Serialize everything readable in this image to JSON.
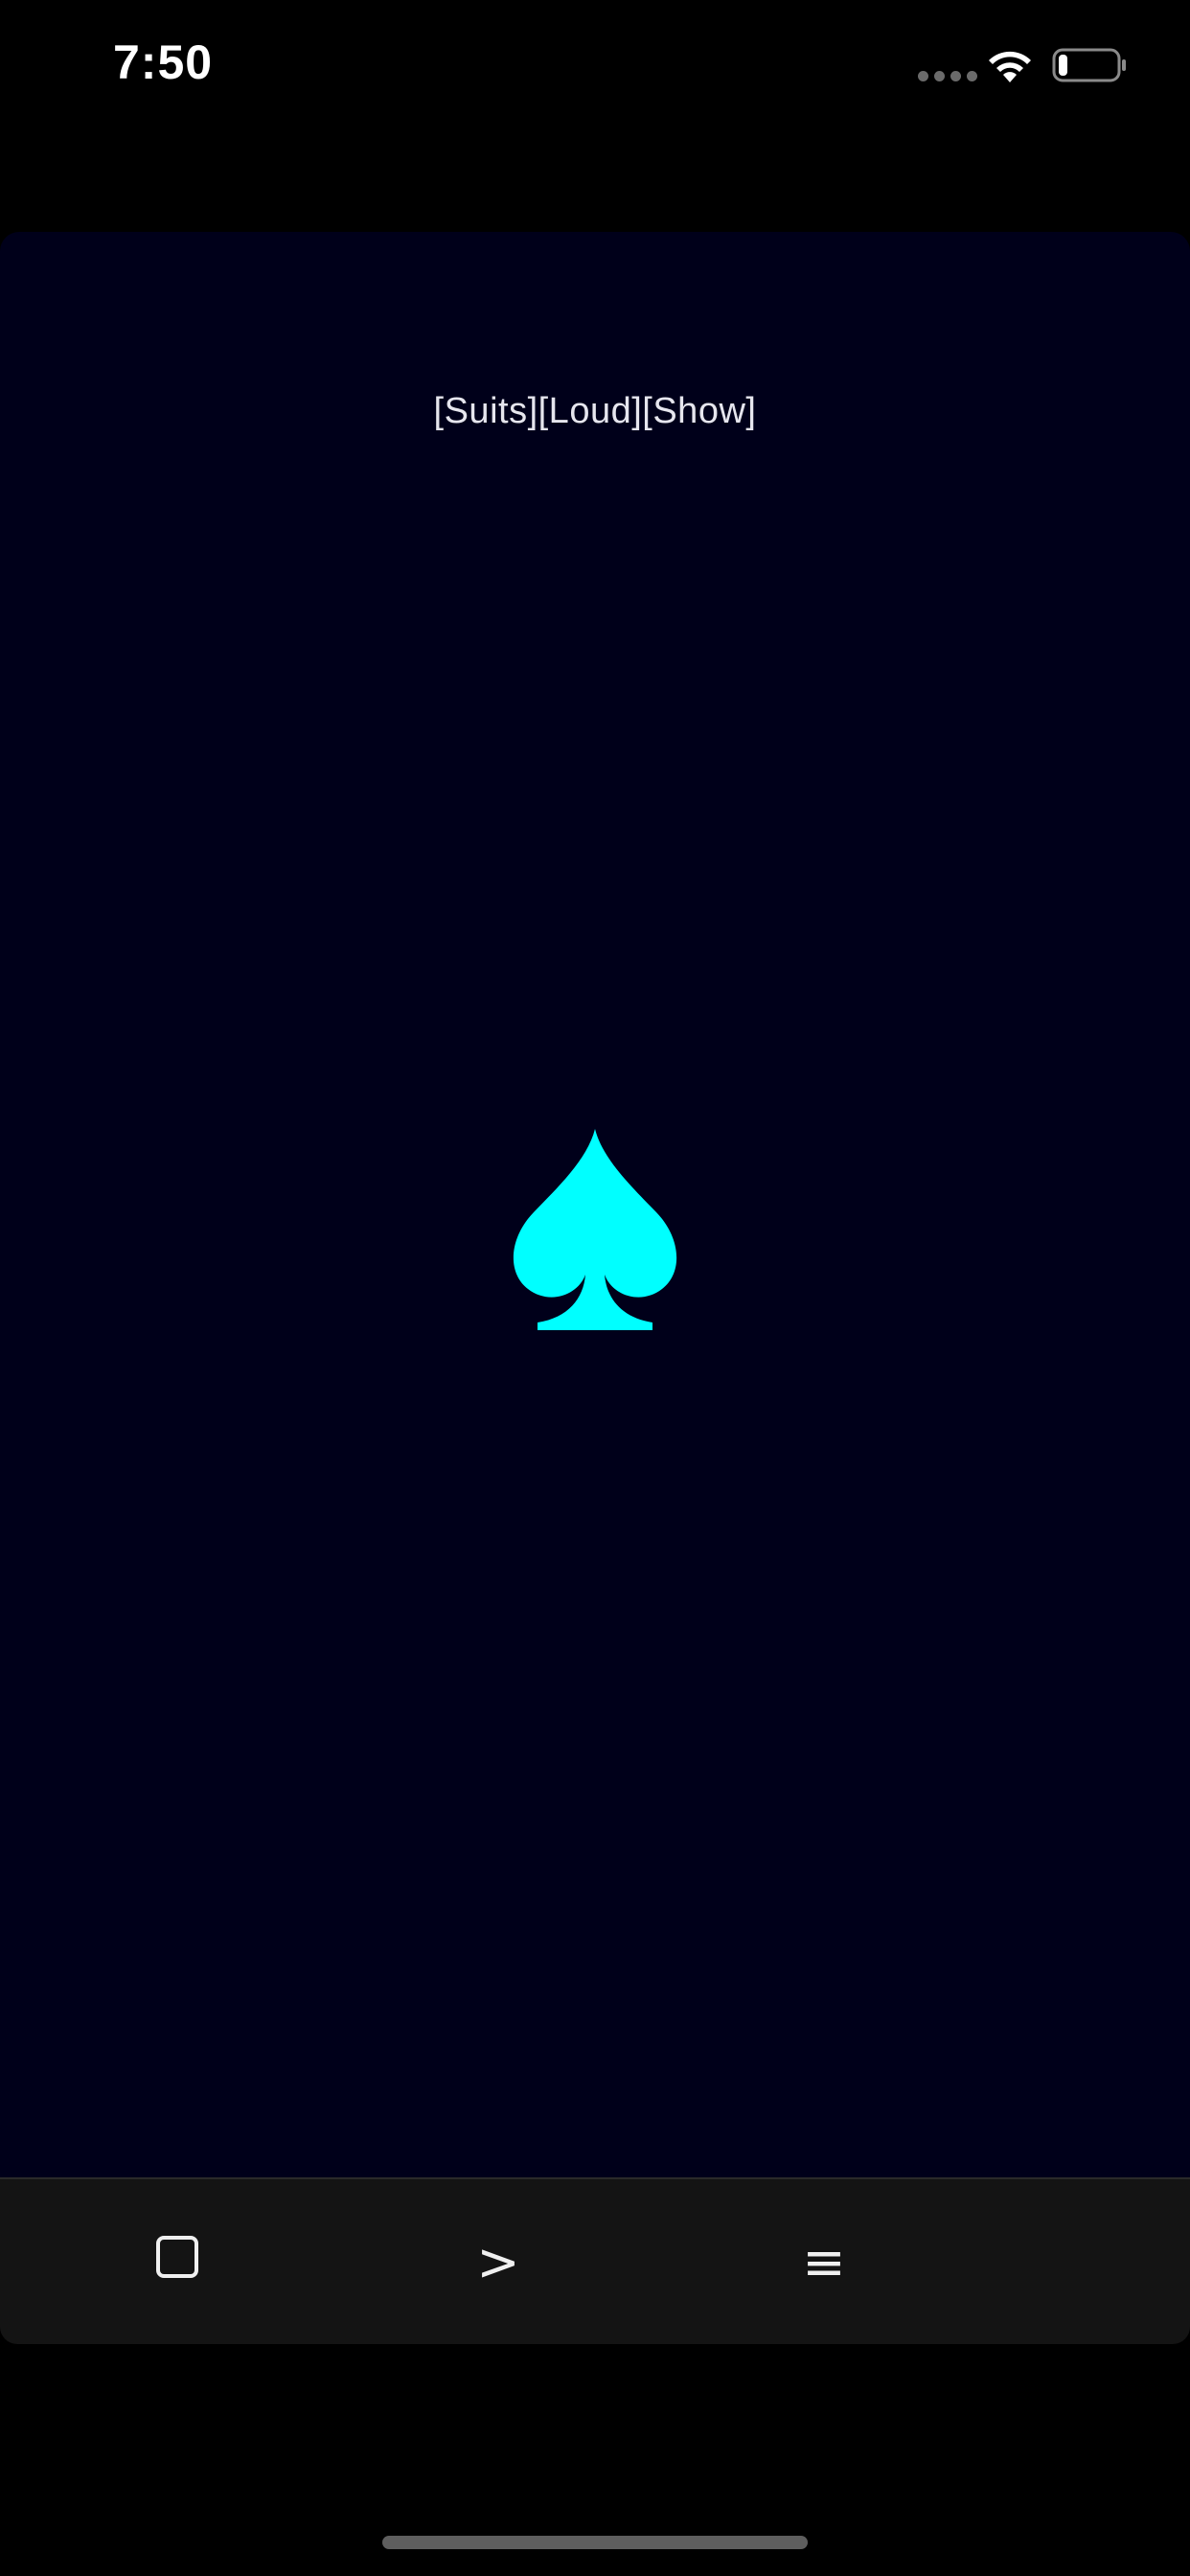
{
  "status_bar": {
    "time": "7:50",
    "wifi_icon": "wifi-icon",
    "battery_icon": "battery-icon",
    "battery_level": 0.15
  },
  "main": {
    "mode_label": "[Suits][Loud][Show]",
    "suit_icon": "spade-icon",
    "suit_color": "#00ffff",
    "background_color": "#00001a"
  },
  "toolbar": {
    "square_icon": "square-icon",
    "next_label": ">",
    "menu_label": "≡"
  }
}
